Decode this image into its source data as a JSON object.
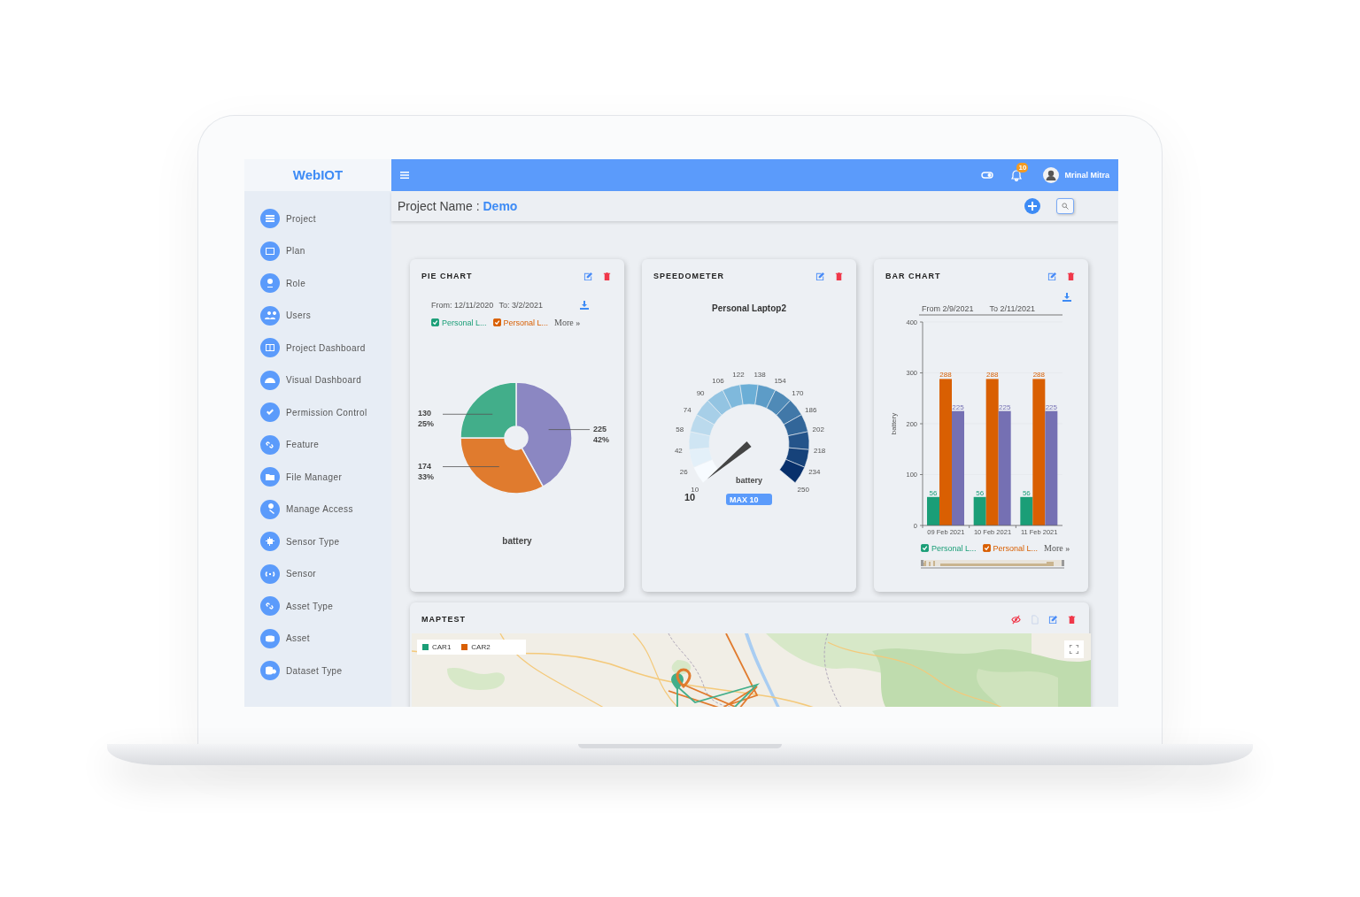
{
  "sidebar": {
    "logo": "WebIOT",
    "items": [
      {
        "label": "Project"
      },
      {
        "label": "Plan"
      },
      {
        "label": "Role"
      },
      {
        "label": "Users"
      },
      {
        "label": "Project Dashboard"
      },
      {
        "label": "Visual Dashboard"
      },
      {
        "label": "Permission Control"
      },
      {
        "label": "Feature"
      },
      {
        "label": "File Manager"
      },
      {
        "label": "Manage Access"
      },
      {
        "label": "Sensor Type"
      },
      {
        "label": "Sensor"
      },
      {
        "label": "Asset Type"
      },
      {
        "label": "Asset"
      },
      {
        "label": "Dataset Type"
      }
    ]
  },
  "topbar": {
    "notification_count": "10",
    "user_name": "Mrinal Mitra"
  },
  "title": "Project Name : **Demo**",
  "pie_card": {
    "title": "PIE CHART",
    "from": "From: 12/11/2020",
    "to": "To: 3/2/2021",
    "legend": [
      {
        "label": "Personal L...",
        "color": "#1a9e77",
        "checked": true
      },
      {
        "label": "Personal L...",
        "color": "#d95f02",
        "checked": true
      }
    ],
    "more": "More »",
    "chart_data": {
      "type": "donut",
      "xlabel": "battery",
      "values": [
        42,
        33,
        25
      ],
      "colors": [
        "#8b87c2",
        "#e07b2e",
        "#42ae8a"
      ],
      "value_labels": [
        [
          "225",
          "42%"
        ],
        [
          "174",
          "33%"
        ],
        [
          "130",
          "25%"
        ]
      ]
    }
  },
  "speedometer_card": {
    "title": "SPEEDOMETER",
    "device": "Personal Laptop2",
    "ticks": [
      "10",
      "26",
      "42",
      "58",
      "74",
      "90",
      "106",
      "122",
      "138",
      "154",
      "170",
      "186",
      "202",
      "218",
      "234",
      "250"
    ],
    "metric": "battery",
    "value": "10",
    "max_label": "MAX 10"
  },
  "bar_card": {
    "title": "BAR CHART",
    "from": "From 2/9/2021",
    "to": "To 2/11/2021",
    "legend": [
      {
        "label": "Personal L...",
        "color": "#1a9e77",
        "checked": true
      },
      {
        "label": "Personal L...",
        "color": "#d95f02",
        "checked": true
      }
    ],
    "more": "More »",
    "chart_data": {
      "type": "bar",
      "ylabel": "battery",
      "categories": [
        "09 Feb 2021",
        "10 Feb 2021",
        "11 Feb 2021"
      ],
      "series": [
        {
          "color": "#1a9e77",
          "values": [
            56,
            56,
            56
          ]
        },
        {
          "color": "#d95f02",
          "values": [
            288,
            288,
            288
          ]
        },
        {
          "color": "#7570b3",
          "values": [
            225,
            225,
            225
          ]
        }
      ],
      "ylim": [
        0,
        400
      ],
      "yticks": [
        0,
        100,
        200,
        300,
        400
      ],
      "data_labels": true
    }
  },
  "map_card": {
    "title": "MAPTEST",
    "legend": [
      {
        "label": "CAR1",
        "color": "#1a9e77"
      },
      {
        "label": "CAR2",
        "color": "#d95f02"
      }
    ]
  }
}
